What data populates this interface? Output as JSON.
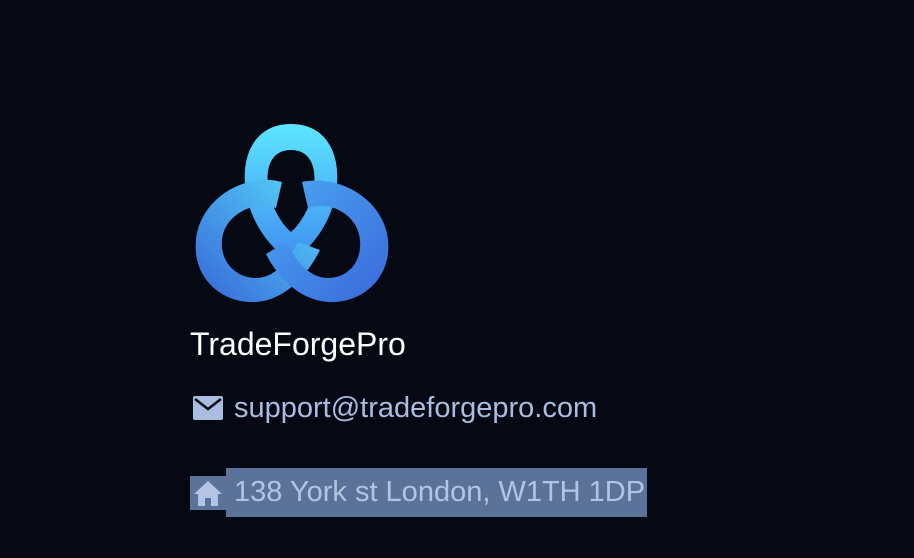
{
  "brand": {
    "name": "TradeForgePro",
    "logo_icon": "trefoil-knot-logo",
    "gradient": [
      "#5ce6ff",
      "#3a6fe0"
    ]
  },
  "contact": {
    "email_icon": "mail-icon",
    "email": "support@tradeforgepro.com",
    "address_icon": "home-icon",
    "address": "138 York st London, W1TH 1DP"
  },
  "colors": {
    "background": "#060814",
    "text_primary": "#ffffff",
    "text_secondary": "#a9bde0",
    "selection": "#5c7399"
  }
}
